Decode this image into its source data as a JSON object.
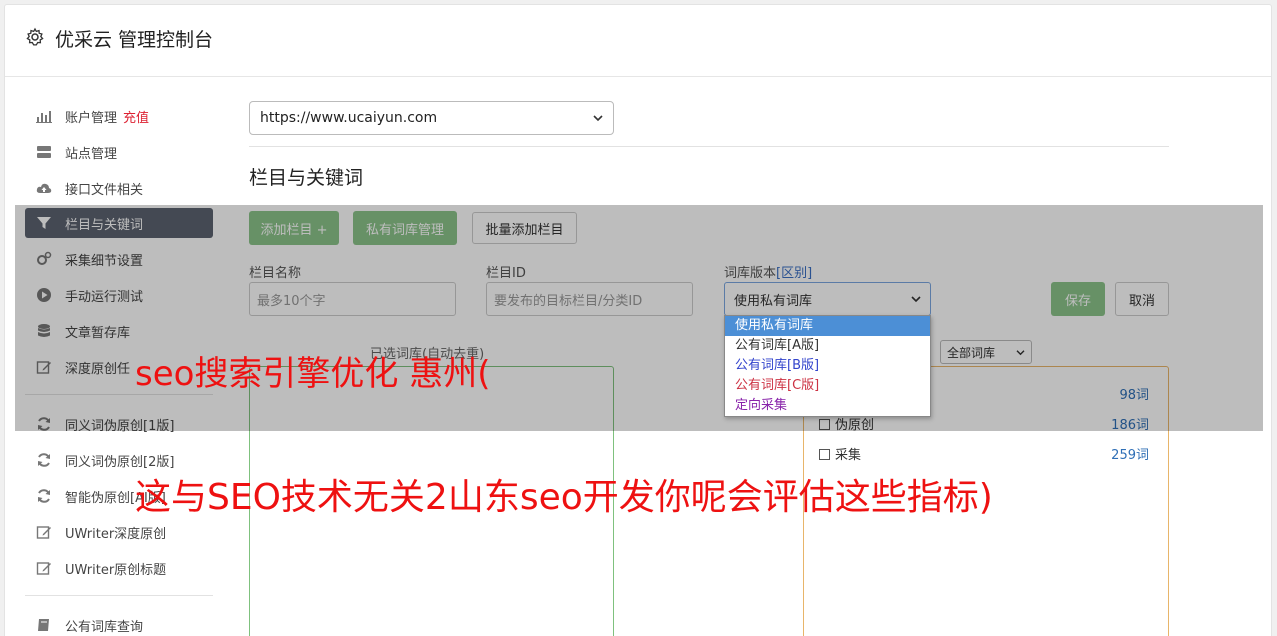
{
  "header": {
    "title": "优采云 管理控制台"
  },
  "sidebar": {
    "items": [
      {
        "label": "账户管理",
        "badge": "充值",
        "icon": "bar-chart-icon"
      },
      {
        "label": "站点管理",
        "icon": "server-icon"
      },
      {
        "label": "接口文件相关",
        "icon": "cloud-upload-icon"
      },
      {
        "label": "栏目与关键词",
        "icon": "filter-icon"
      },
      {
        "label": "采集细节设置",
        "icon": "cogs-icon"
      },
      {
        "label": "手动运行测试",
        "icon": "play-circle-icon"
      },
      {
        "label": "文章暂存库",
        "icon": "database-icon"
      },
      {
        "label": "深度原创任",
        "icon": "edit-icon"
      },
      {
        "label": "同义词伪原创[1版]",
        "icon": "refresh-icon"
      },
      {
        "label": "同义词伪原创[2版]",
        "icon": "refresh-icon"
      },
      {
        "label": "智能伪原创[AI版]",
        "icon": "refresh-icon"
      },
      {
        "label": "UWriter深度原创",
        "icon": "edit-icon"
      },
      {
        "label": "UWriter原创标题",
        "icon": "edit-icon"
      },
      {
        "label": "公有词库查询",
        "icon": "book-icon"
      }
    ]
  },
  "main": {
    "site_select": "https://www.ucaiyun.com",
    "section_title": "栏目与关键词",
    "buttons": {
      "add_column": "添加栏目 +",
      "private_lib": "私有词库管理",
      "batch_add": "批量添加栏目",
      "save": "保存",
      "cancel": "取消"
    },
    "form": {
      "name_label": "栏目名称",
      "name_placeholder": "最多10个字",
      "id_label": "栏目ID",
      "id_placeholder": "要发布的目标栏目/分类ID",
      "version_label": "词库版本",
      "version_link": "[区别]",
      "version_value": "使用私有词库"
    },
    "version_options": [
      "使用私有词库",
      "公有词库[A版]",
      "公有词库[B版]",
      "公有词库[C版]",
      "定向采集"
    ],
    "option_colors": [
      "#ffffff",
      "#333333",
      "#3344cc",
      "#cc3344",
      "#8822aa"
    ],
    "selected_caption": "已选词库(自动去重)",
    "lib_filter": "全部词库",
    "word_rows": [
      {
        "label": "",
        "count": "98词"
      },
      {
        "label": "伪原创",
        "count": "186词"
      },
      {
        "label": "采集",
        "count": "259词"
      }
    ]
  },
  "overlay_text": {
    "line1": "seo搜索引擎优化 惠州(",
    "line2": "这与SEO技术无关2山东seo开发你呢会评估这些指标)"
  }
}
